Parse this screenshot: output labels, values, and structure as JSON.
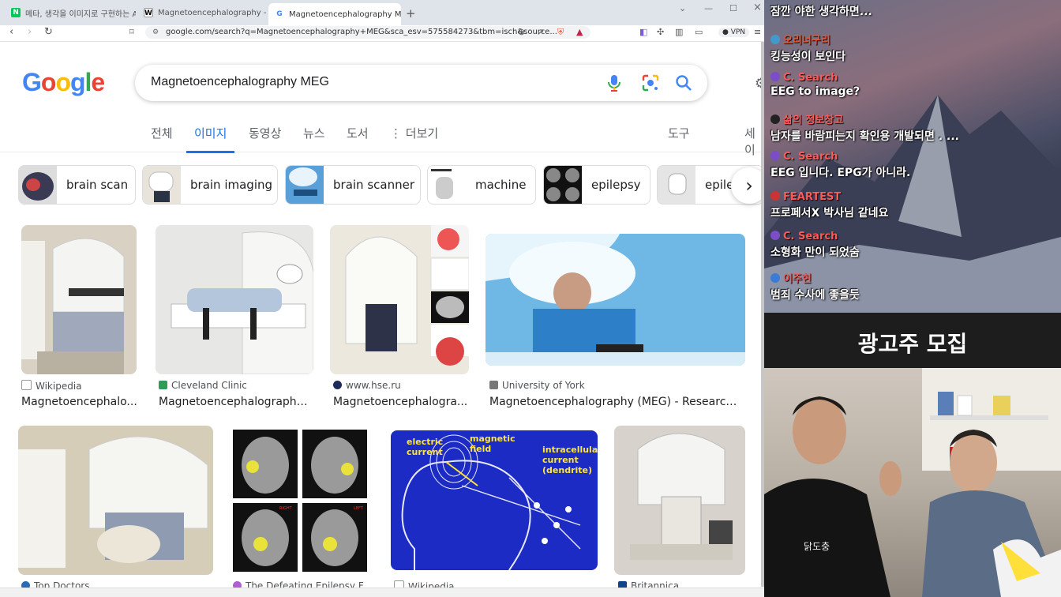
{
  "tabs": [
    {
      "label": "메타, 생각을 이미지로 구현하는 AI 공",
      "favicon": "N"
    },
    {
      "label": "Magnetoencephalography - Wikiped",
      "favicon": "W"
    },
    {
      "label": "Magnetoencephalography MEG",
      "favicon": "G"
    }
  ],
  "address": {
    "url": "google.com/search?q=Magnetoencephalography+MEG&sca_esv=575584273&tbm=isch&source...",
    "vpn": "VPN"
  },
  "search": {
    "query": "Magnetoencephalography MEG"
  },
  "nav": {
    "items": [
      "전체",
      "이미지",
      "동영상",
      "뉴스",
      "도서",
      "더보기"
    ],
    "tools": "도구",
    "safe": "세이"
  },
  "chips": [
    "brain scan",
    "brain imaging",
    "brain scanner",
    "machine",
    "epilepsy",
    "epile"
  ],
  "results_row1": [
    {
      "source": "Wikipedia",
      "title": "Magnetoencephalo..."
    },
    {
      "source": "Cleveland Clinic",
      "title": "Magnetoencephalography ..."
    },
    {
      "source": "www.hse.ru",
      "title": "Magnetoencephalogra..."
    },
    {
      "source": "University of York",
      "title": "Magnetoencephalography (MEG) - Research, ..."
    }
  ],
  "results_row2": [
    {
      "source": "Top Doctors"
    },
    {
      "source": "The Defeating Epilepsy F..."
    },
    {
      "source": "Wikipedia"
    },
    {
      "source": "Britannica"
    }
  ],
  "diagram_labels": {
    "electric": "electric",
    "current": "current",
    "magnetic": "magnetic",
    "field": "field",
    "intracellular": "intracellular",
    "current2": "current",
    "dendrite": "(dendrite)"
  },
  "mri_labels": {
    "right": "RIGHT",
    "left": "LEFT"
  },
  "chat": [
    {
      "user": "",
      "text": "잠깐 야한 생각하면..."
    },
    {
      "user": "오리너구리",
      "text": "킹능성이 보인다"
    },
    {
      "user": "C. Search",
      "text": "EEG to image?"
    },
    {
      "user": "삶의 정보창고",
      "text": "남자를 바람피는지 확인용 개발되면 . ..."
    },
    {
      "user": "C. Search",
      "text": "EEG 입니다. EPG가 아니라."
    },
    {
      "user": "FEARTEST",
      "text": "프로페서X 박사님 같네요"
    },
    {
      "user": "C. Search",
      "text": "소형화 만이 되었숨"
    },
    {
      "user": "이주현",
      "text": "범죄 수사에 좋을듯"
    }
  ],
  "banner": "광고주 모집",
  "shirt_text": "닭도충",
  "colors": {
    "google_blue": "#4285F4",
    "google_red": "#EA4335",
    "google_yellow": "#FBBC05",
    "google_green": "#34A853",
    "link_blue": "#1a73e8"
  }
}
